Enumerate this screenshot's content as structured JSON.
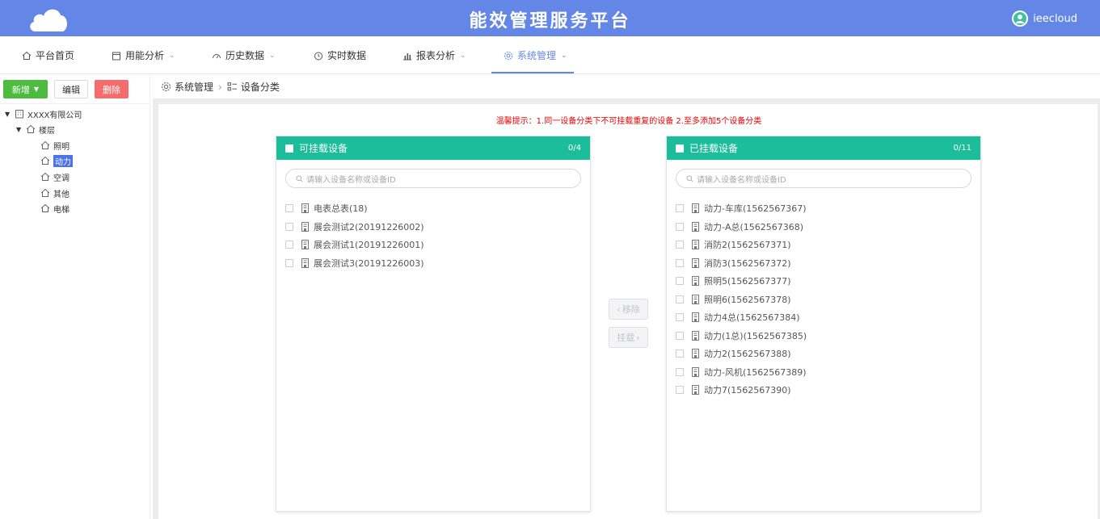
{
  "header": {
    "title": "能效管理服务平台",
    "username": "ieecloud",
    "bg_color": "#6487e7"
  },
  "nav": [
    {
      "label": "平台首页",
      "icon": "home-icon",
      "has_dropdown": false
    },
    {
      "label": "用能分析",
      "icon": "calendar-icon",
      "has_dropdown": true
    },
    {
      "label": "历史数据",
      "icon": "gauge-icon",
      "has_dropdown": true
    },
    {
      "label": "实时数据",
      "icon": "clock-icon",
      "has_dropdown": false
    },
    {
      "label": "报表分析",
      "icon": "bar-chart-icon",
      "has_dropdown": true
    },
    {
      "label": "系统管理",
      "icon": "gear-icon",
      "has_dropdown": true,
      "active": true
    }
  ],
  "toolbar": {
    "new_label": "新增",
    "edit_label": "编辑",
    "delete_label": "删除"
  },
  "tree": {
    "root": "XXXX有限公司",
    "level1": "楼层",
    "children": [
      "照明",
      "动力",
      "空调",
      "其他",
      "电梯"
    ],
    "selected": "动力"
  },
  "breadcrumb": {
    "first": "系统管理",
    "second": "设备分类"
  },
  "tip": "温馨提示：1.同一设备分类下不可挂载重复的设备 2.至多添加5个设备分类",
  "available": {
    "title": "可挂载设备",
    "count": "0/4",
    "search_placeholder": "请输入设备名称或设备ID",
    "items": [
      "电表总表(18)",
      "展会测试2(20191226002)",
      "展会测试1(20191226001)",
      "展会测试3(20191226003)"
    ]
  },
  "mounted": {
    "title": "已挂载设备",
    "count": "0/11",
    "search_placeholder": "请输入设备名称或设备ID",
    "items": [
      "动力-车库(1562567367)",
      "动力-A总(1562567368)",
      "消防2(1562567371)",
      "消防3(1562567372)",
      "照明5(1562567377)",
      "照明6(1562567378)",
      "动力4总(1562567384)",
      "动力(1总)(1562567385)",
      "动力2(1562567388)",
      "动力-风机(1562567389)",
      "动力7(1562567390)"
    ]
  },
  "transfer": {
    "remove_label": "移除",
    "mount_label": "挂载"
  },
  "colors": {
    "accent": "#6487e7",
    "panel_header": "#1bbd9a",
    "new_button": "#4dbb3f",
    "delete_button": "#f56c6c",
    "tip_text": "#ee0000"
  }
}
